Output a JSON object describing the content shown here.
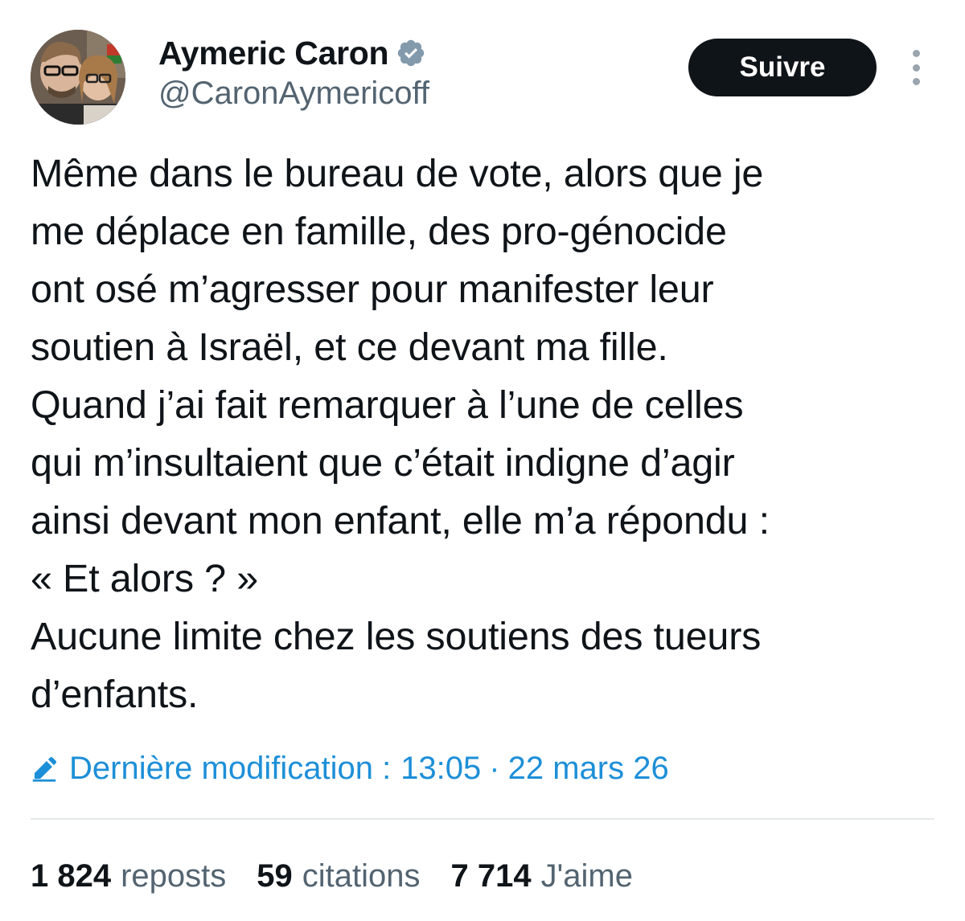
{
  "author": {
    "display_name": "Aymeric Caron",
    "handle": "@CaronAymericoff",
    "verified": true
  },
  "actions": {
    "follow_label": "Suivre"
  },
  "tweet": {
    "lines": [
      "Même dans le bureau de vote, alors que je",
      "me déplace en famille, des pro-génocide",
      "ont osé m’agresser pour manifester leur",
      "soutien à Israël, et ce devant ma fille.",
      "Quand j’ai fait remarquer à l’une de celles",
      "qui m’insultaient que c’était indigne d’agir",
      "ainsi devant mon enfant, elle m’a répondu :",
      "« Et alors ? »",
      "Aucune limite chez les soutiens des tueurs",
      "d’enfants."
    ]
  },
  "edit_info": {
    "label": "Dernière modification :",
    "time": "13:05",
    "separator": "·",
    "date": "22 mars 26"
  },
  "stats": {
    "reposts_count": "1 824",
    "reposts_label": "reposts",
    "quotes_count": "59",
    "quotes_label": "citations",
    "likes_count": "7 714",
    "likes_label": "J'aime"
  },
  "colors": {
    "text_primary": "#0f1419",
    "text_secondary": "#536471",
    "link_blue": "#1d8fd8",
    "follow_button_bg": "#0f1419",
    "verified_gray": "#829aab",
    "divider": "#e6e9eb"
  },
  "icons": {
    "verified": "verified-badge-icon",
    "more": "more-vertical-icon",
    "edit": "pencil-edit-icon"
  }
}
